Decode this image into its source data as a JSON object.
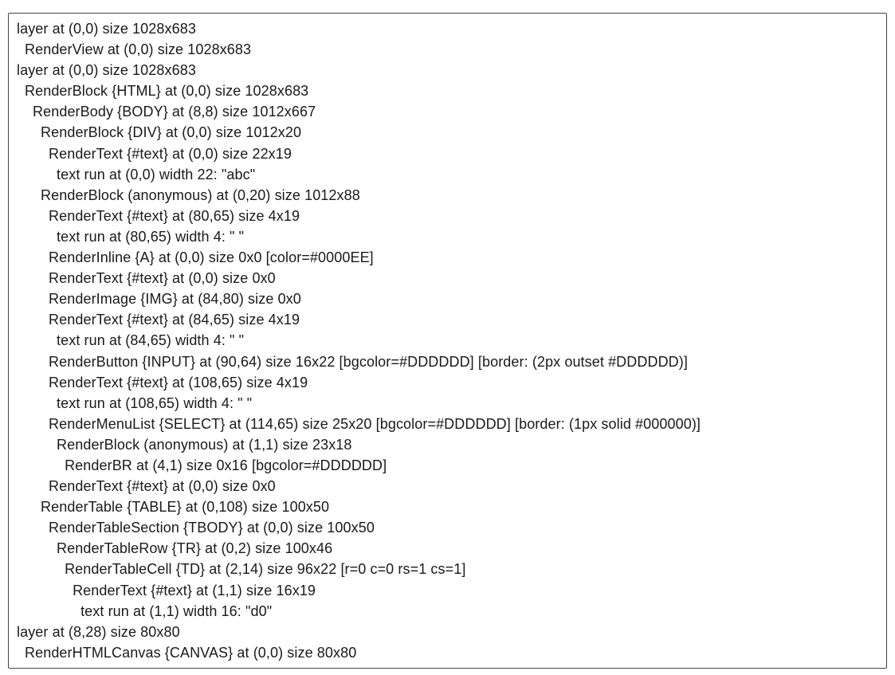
{
  "lines": [
    {
      "indent": 0,
      "text": "layer at (0,0) size 1028x683"
    },
    {
      "indent": 1,
      "text": "RenderView at (0,0) size 1028x683"
    },
    {
      "indent": 0,
      "text": "layer at (0,0) size 1028x683"
    },
    {
      "indent": 1,
      "text": "RenderBlock {HTML} at (0,0) size 1028x683"
    },
    {
      "indent": 2,
      "text": "RenderBody {BODY} at (8,8) size 1012x667"
    },
    {
      "indent": 3,
      "text": "RenderBlock {DIV} at (0,0) size 1012x20"
    },
    {
      "indent": 4,
      "text": "RenderText {#text} at (0,0) size 22x19"
    },
    {
      "indent": 5,
      "text": "text run at (0,0) width 22: \"abc\""
    },
    {
      "indent": 3,
      "text": "RenderBlock (anonymous) at (0,20) size 1012x88"
    },
    {
      "indent": 4,
      "text": "RenderText {#text} at (80,65) size 4x19"
    },
    {
      "indent": 5,
      "text": "text run at (80,65) width 4: \" \""
    },
    {
      "indent": 4,
      "text": "RenderInline {A} at (0,0) size 0x0 [color=#0000EE]"
    },
    {
      "indent": 4,
      "text": "RenderText {#text} at (0,0) size 0x0"
    },
    {
      "indent": 4,
      "text": "RenderImage {IMG} at (84,80) size 0x0"
    },
    {
      "indent": 4,
      "text": "RenderText {#text} at (84,65) size 4x19"
    },
    {
      "indent": 5,
      "text": "text run at (84,65) width 4: \" \""
    },
    {
      "indent": 4,
      "text": "RenderButton {INPUT} at (90,64) size 16x22 [bgcolor=#DDDDDD] [border: (2px outset #DDDDDD)]"
    },
    {
      "indent": 4,
      "text": "RenderText {#text} at (108,65) size 4x19"
    },
    {
      "indent": 5,
      "text": "text run at (108,65) width 4: \" \""
    },
    {
      "indent": 4,
      "text": "RenderMenuList {SELECT} at (114,65) size 25x20 [bgcolor=#DDDDDD] [border: (1px solid #000000)]"
    },
    {
      "indent": 5,
      "text": "RenderBlock (anonymous) at (1,1) size 23x18"
    },
    {
      "indent": 6,
      "text": "RenderBR at (4,1) size 0x16 [bgcolor=#DDDDDD]"
    },
    {
      "indent": 4,
      "text": "RenderText {#text} at (0,0) size 0x0"
    },
    {
      "indent": 3,
      "text": "RenderTable {TABLE} at (0,108) size 100x50"
    },
    {
      "indent": 4,
      "text": "RenderTableSection {TBODY} at (0,0) size 100x50"
    },
    {
      "indent": 5,
      "text": "RenderTableRow {TR} at (0,2) size 100x46"
    },
    {
      "indent": 6,
      "text": "RenderTableCell {TD} at (2,14) size 96x22 [r=0 c=0 rs=1 cs=1]"
    },
    {
      "indent": 7,
      "text": "RenderText {#text} at (1,1) size 16x19"
    },
    {
      "indent": 8,
      "text": "text run at (1,1) width 16: \"d0\""
    },
    {
      "indent": 0,
      "text": "layer at (8,28) size 80x80"
    },
    {
      "indent": 1,
      "text": "RenderHTMLCanvas {CANVAS} at (0,0) size 80x80"
    }
  ]
}
